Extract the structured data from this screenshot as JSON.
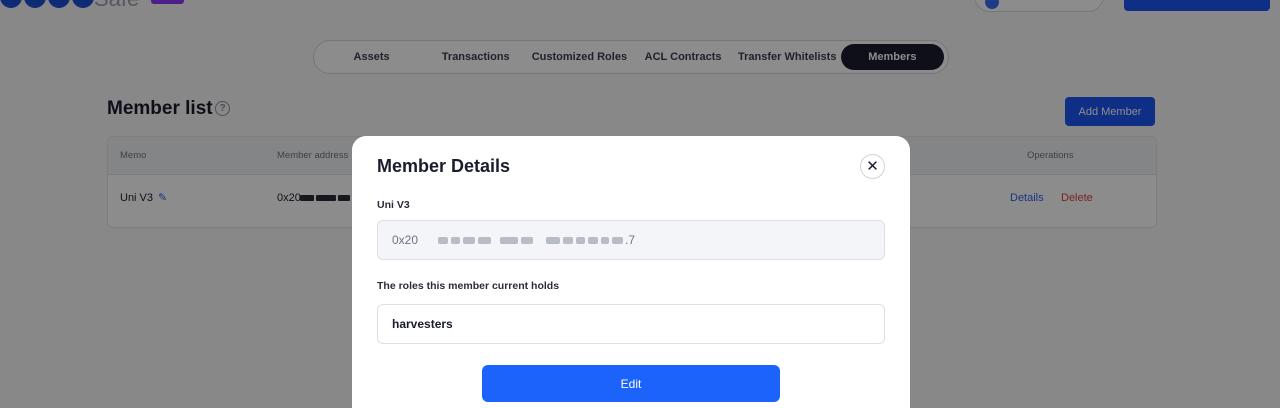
{
  "header": {
    "logo_text": "Safe"
  },
  "tabs": [
    {
      "label": "Assets",
      "active": false
    },
    {
      "label": "Transactions",
      "active": false
    },
    {
      "label": "Customized Roles",
      "active": false
    },
    {
      "label": "ACL Contracts",
      "active": false
    },
    {
      "label": "Transfer Whitelists",
      "active": false
    },
    {
      "label": "Members",
      "active": true
    }
  ],
  "member_list": {
    "title": "Member list",
    "add_button": "Add Member",
    "columns": {
      "memo": "Memo",
      "address": "Member address",
      "operations": "Operations"
    },
    "rows": [
      {
        "memo": "Uni V3",
        "address": "0x20",
        "details": "Details",
        "delete": "Delete"
      }
    ]
  },
  "modal": {
    "title": "Member Details",
    "memo": "Uni V3",
    "address_prefix": "0x20",
    "address_suffix": ".7",
    "roles_label": "The roles this member current holds",
    "roles_value": "harvesters",
    "edit_button": "Edit"
  },
  "colors": {
    "primary": "#1c55f5",
    "dark": "#1a1d2e",
    "danger": "#e0403f"
  },
  "icons": [
    "help-icon",
    "pencil-icon",
    "close-icon"
  ]
}
